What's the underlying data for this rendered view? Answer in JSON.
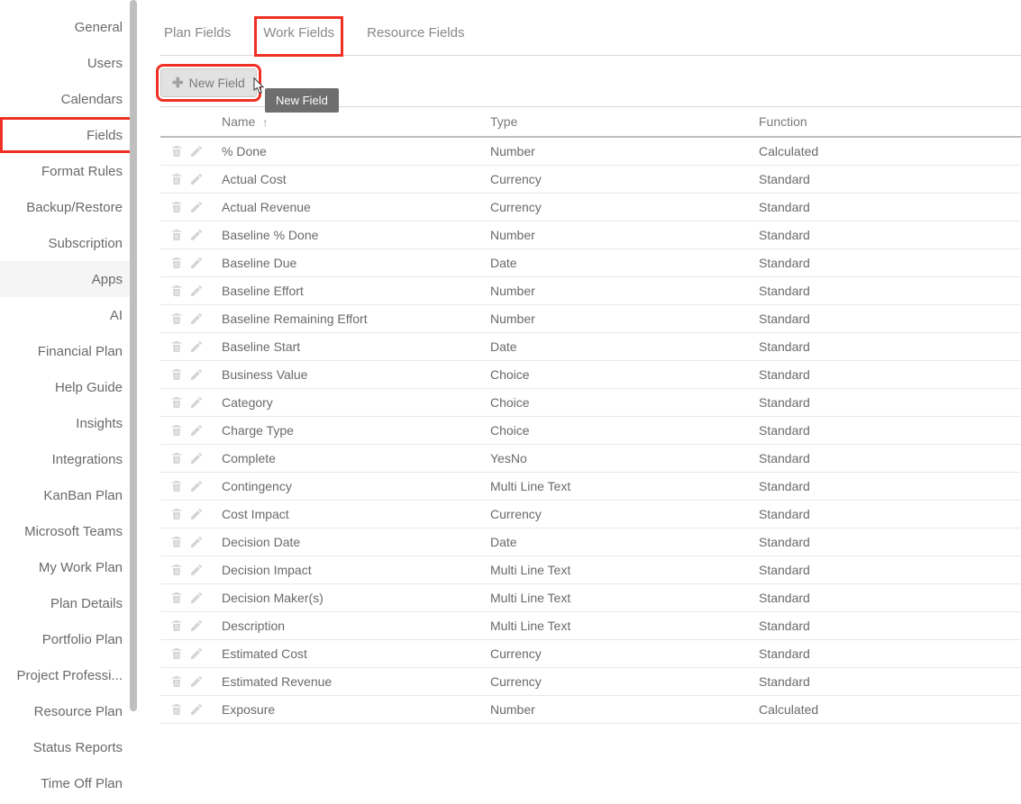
{
  "sidebar": {
    "items": [
      {
        "label": "General"
      },
      {
        "label": "Users"
      },
      {
        "label": "Calendars"
      },
      {
        "label": "Fields",
        "highlighted": true
      },
      {
        "label": "Format Rules"
      },
      {
        "label": "Backup/Restore"
      },
      {
        "label": "Subscription"
      },
      {
        "label": "Apps",
        "active": true
      },
      {
        "label": "AI"
      },
      {
        "label": "Financial Plan"
      },
      {
        "label": "Help Guide"
      },
      {
        "label": "Insights"
      },
      {
        "label": "Integrations"
      },
      {
        "label": "KanBan Plan"
      },
      {
        "label": "Microsoft Teams"
      },
      {
        "label": "My Work Plan"
      },
      {
        "label": "Plan Details"
      },
      {
        "label": "Portfolio Plan"
      },
      {
        "label": "Project Professi..."
      },
      {
        "label": "Resource Plan"
      },
      {
        "label": "Status Reports"
      },
      {
        "label": "Time Off Plan"
      }
    ]
  },
  "tabs": [
    {
      "label": "Plan Fields"
    },
    {
      "label": "Work Fields",
      "highlighted": true
    },
    {
      "label": "Resource Fields"
    }
  ],
  "toolbar": {
    "new_field_label": "New Field",
    "tooltip": "New Field"
  },
  "table": {
    "headers": {
      "name": "Name",
      "type": "Type",
      "function": "Function"
    },
    "rows": [
      {
        "name": "% Done",
        "type": "Number",
        "function": "Calculated"
      },
      {
        "name": "Actual Cost",
        "type": "Currency",
        "function": "Standard"
      },
      {
        "name": "Actual Revenue",
        "type": "Currency",
        "function": "Standard"
      },
      {
        "name": "Baseline % Done",
        "type": "Number",
        "function": "Standard"
      },
      {
        "name": "Baseline Due",
        "type": "Date",
        "function": "Standard"
      },
      {
        "name": "Baseline Effort",
        "type": "Number",
        "function": "Standard"
      },
      {
        "name": "Baseline Remaining Effort",
        "type": "Number",
        "function": "Standard"
      },
      {
        "name": "Baseline Start",
        "type": "Date",
        "function": "Standard"
      },
      {
        "name": "Business Value",
        "type": "Choice",
        "function": "Standard"
      },
      {
        "name": "Category",
        "type": "Choice",
        "function": "Standard"
      },
      {
        "name": "Charge Type",
        "type": "Choice",
        "function": "Standard"
      },
      {
        "name": "Complete",
        "type": "YesNo",
        "function": "Standard"
      },
      {
        "name": "Contingency",
        "type": "Multi Line Text",
        "function": "Standard"
      },
      {
        "name": "Cost Impact",
        "type": "Currency",
        "function": "Standard"
      },
      {
        "name": "Decision Date",
        "type": "Date",
        "function": "Standard"
      },
      {
        "name": "Decision Impact",
        "type": "Multi Line Text",
        "function": "Standard"
      },
      {
        "name": "Decision Maker(s)",
        "type": "Multi Line Text",
        "function": "Standard"
      },
      {
        "name": "Description",
        "type": "Multi Line Text",
        "function": "Standard"
      },
      {
        "name": "Estimated Cost",
        "type": "Currency",
        "function": "Standard"
      },
      {
        "name": "Estimated Revenue",
        "type": "Currency",
        "function": "Standard"
      },
      {
        "name": "Exposure",
        "type": "Number",
        "function": "Calculated"
      }
    ]
  }
}
